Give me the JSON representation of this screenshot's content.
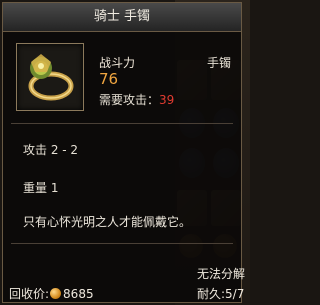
{
  "tooltip": {
    "title": "骑士 手镯",
    "power_label": "战斗力",
    "power_value": "76",
    "requirement_label": "需要攻击：",
    "requirement_value": "39",
    "category": "手镯",
    "attack": "攻击 2 - 2",
    "weight": "重量 1",
    "description": "只有心怀光明之人才能佩戴它。",
    "no_decompose": "无法分解",
    "durability": "耐久:5/7",
    "resale_label": "回收价:",
    "resale_value": "8685",
    "coin_icon": "gold-coin-icon"
  },
  "colors": {
    "power_value": "#f1a640",
    "requirement_value": "#e13b30",
    "border": "#6a5a44"
  }
}
